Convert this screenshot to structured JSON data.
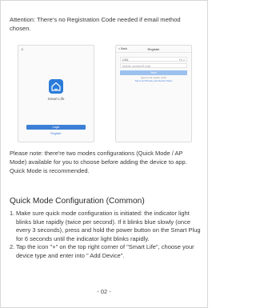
{
  "attention": "Attention: There's no Registration Code needed if email method chosen.",
  "phone1": {
    "close_glyph": "×",
    "app_name": "Smart Life",
    "login_label": "Login",
    "register_label": "Register",
    "icon": "home-icon",
    "accent": "#2b7bd9"
  },
  "phone2": {
    "back_label": "< Back",
    "title": "Register",
    "country": "USA",
    "country_code": "+1 >",
    "mobile_placeholder": "Mobile number/E-mail",
    "next_label": "Next",
    "agree_text": "Agree to all register under",
    "agree_link": "Terms and Privacy and Service Policy"
  },
  "note": "Please note: there're two modes configurations (Quick Mode / AP Mode) available for you to choose before adding the device to app. Quick Mode is recommended.",
  "section_title": "Quick Mode Configuration (Common)",
  "steps": [
    {
      "num": "1.",
      "text": "Make sure quick mode configuration is initiated: the indicator light blinks blue rapidly (twice per second). If it blinks blue slowly (once every 3 seconds), press and hold the power button on the Smart Plug for 6 seconds until the indicator light blinks rapidly."
    },
    {
      "num": "2.",
      "text": "Tap the icon \"+\" on the top right corner of \"Smart Life\", choose your device type and enter into \" Add Device\"."
    }
  ],
  "page_number": "- 02 -"
}
